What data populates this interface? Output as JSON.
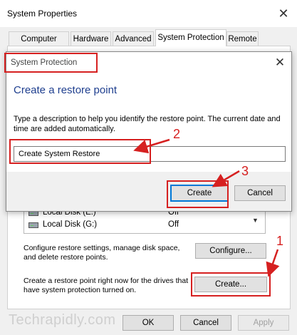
{
  "window": {
    "title": "System Properties",
    "close_glyph": "✕",
    "tabs": [
      {
        "label": "Computer Name",
        "active": false
      },
      {
        "label": "Hardware",
        "active": false
      },
      {
        "label": "Advanced",
        "active": false
      },
      {
        "label": "System Protection",
        "active": true
      },
      {
        "label": "Remote",
        "active": false
      }
    ]
  },
  "drives": [
    {
      "name": "Local Disk (E:)",
      "status": "Off",
      "icon": "drive-icon"
    },
    {
      "name": "Local Disk (G:)",
      "status": "Off",
      "icon": "drive-icon"
    }
  ],
  "configure_section": {
    "text": "Configure restore settings, manage disk space, and delete restore points.",
    "button_label": "Configure..."
  },
  "create_section": {
    "text": "Create a restore point right now for the drives that have system protection turned on.",
    "button_label": "Create..."
  },
  "footer": {
    "ok_label": "OK",
    "cancel_label": "Cancel",
    "apply_label": "Apply"
  },
  "dialog": {
    "title": "System Protection",
    "close_glyph": "✕",
    "heading": "Create a restore point",
    "description": "Type a description to help you identify the restore point. The current date and time are added automatically.",
    "input_value": "Create System Restore",
    "create_label": "Create",
    "cancel_label": "Cancel"
  },
  "annotations": {
    "step1": "1",
    "step2": "2",
    "step3": "3",
    "color": "#d62020"
  },
  "watermark": "Techrapidly.com"
}
